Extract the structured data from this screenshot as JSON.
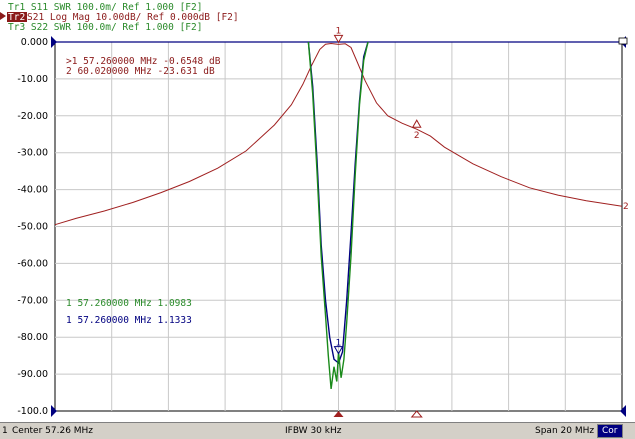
{
  "colors": {
    "tr1": "#2a8a2a",
    "tr2": "#8b1a1a",
    "tr3": "#2a8a2a",
    "s11_trace": "#1a8a1a",
    "s21_trace": "#a02020",
    "s22_trace": "#000080",
    "grid": "#c8c8c8",
    "frame": "#000000",
    "ref_line": "#000080"
  },
  "header": {
    "traces": [
      {
        "text": "Tr1 S11 SWR 100.0m/ Ref 1.000 [F2]",
        "active": false,
        "color": "#2a8a2a"
      },
      {
        "text": " S21 Log Mag 10.00dB/ Ref 0.000dB [F2]",
        "badge": "Tr2",
        "active": true,
        "color": "#8b1a1a"
      },
      {
        "text": "Tr3 S22 SWR 100.0m/ Ref 1.000 [F2]",
        "active": false,
        "color": "#2a8a2a"
      }
    ]
  },
  "marker_tables": [
    {
      "lines": [
        ">1  57.260000 MHz -0.6548 dB",
        " 2  60.020000 MHz -23.631 dB"
      ],
      "color": "#8b1a1a"
    },
    {
      "lines": [
        " 1  57.260000 MHz  1.0983"
      ],
      "color": "#2a8a2a"
    },
    {
      "lines": [
        " 1  57.260000 MHz  1.1333"
      ],
      "color": "#000080"
    }
  ],
  "status": {
    "channel": "1",
    "center": "Center 57.26 MHz",
    "ifbw": "IFBW 30 kHz",
    "span": "Span 20 MHz",
    "cor": "Cor"
  },
  "chart_data": {
    "type": "line",
    "x_unit": "MHz",
    "xlim": [
      47.26,
      67.26
    ],
    "ylim": [
      -100,
      0
    ],
    "y_ticks": [
      0,
      -10,
      -20,
      -30,
      -40,
      -50,
      -60,
      -70,
      -80,
      -90,
      -100
    ],
    "y_tick_labels": [
      "0.000",
      "-10.00",
      "-20.00",
      "-30.00",
      "-40.00",
      "-50.00",
      "-60.00",
      "-70.00",
      "-80.00",
      "-90.00",
      "-100.0"
    ],
    "x_divisions": 10,
    "grid": true,
    "series": [
      {
        "trace": "S21",
        "color": "#a02020",
        "x": [
          47.26,
          48.0,
          49.0,
          50.0,
          51.0,
          52.0,
          53.0,
          54.0,
          55.0,
          55.6,
          56.0,
          56.3,
          56.6,
          56.8,
          57.0,
          57.26,
          57.5,
          57.7,
          57.9,
          58.2,
          58.6,
          59.0,
          59.5,
          60.02,
          60.5,
          61.0,
          62.0,
          63.0,
          64.0,
          65.0,
          66.0,
          67.26
        ],
        "y": [
          -49.5,
          -47.8,
          -45.8,
          -43.5,
          -40.8,
          -37.8,
          -34.2,
          -29.5,
          -22.5,
          -17.0,
          -11.5,
          -6.5,
          -2.0,
          -0.6,
          -0.4,
          -0.65,
          -0.5,
          -1.5,
          -5.0,
          -10.5,
          -16.5,
          -20.0,
          -22.0,
          -23.63,
          -25.5,
          -28.5,
          -33.0,
          -36.5,
          -39.5,
          -41.5,
          -43.0,
          -44.5
        ]
      },
      {
        "trace": "S22",
        "color": "#000080",
        "x": [
          56.2,
          56.35,
          56.5,
          56.65,
          56.8,
          56.95,
          57.1,
          57.26,
          57.4,
          57.55,
          57.7,
          57.85,
          58.0,
          58.15,
          58.3
        ],
        "y": [
          0,
          -12,
          -32,
          -55,
          -70,
          -80,
          -86,
          -87,
          -84,
          -70,
          -52,
          -33,
          -16,
          -4,
          0
        ]
      },
      {
        "trace": "S11",
        "color": "#1a8a1a",
        "x": [
          56.2,
          56.35,
          56.5,
          56.65,
          56.8,
          56.9,
          57.0,
          57.1,
          57.2,
          57.26,
          57.35,
          57.45,
          57.55,
          57.7,
          57.85,
          58.0,
          58.15,
          58.3
        ],
        "y": [
          0,
          -14,
          -35,
          -58,
          -74,
          -85,
          -94,
          -88,
          -92,
          -84,
          -91,
          -86,
          -76,
          -58,
          -36,
          -17,
          -5,
          0
        ]
      }
    ],
    "markers": [
      {
        "label": "1",
        "x": 57.26,
        "y": -0.65,
        "trace": "S21"
      },
      {
        "label": "2",
        "x": 60.02,
        "y": -23.63,
        "trace": "S21"
      },
      {
        "label": "1",
        "x": 57.26,
        "y": -85,
        "trace": "S22"
      }
    ],
    "end_label": "2"
  }
}
